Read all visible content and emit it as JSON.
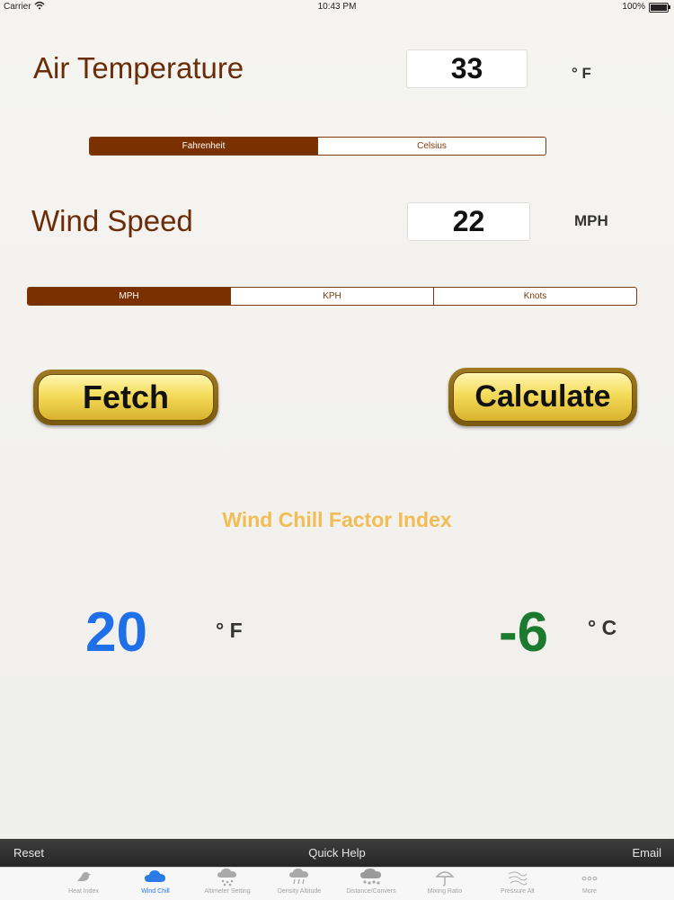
{
  "status_bar": {
    "carrier": "Carrier",
    "time": "10:43 PM",
    "battery": "100%"
  },
  "air_temperature": {
    "label": "Air Temperature",
    "value": "33",
    "unit": "° F",
    "unit_options": [
      "Fahrenheit",
      "Celsius"
    ],
    "selected": "Fahrenheit"
  },
  "wind_speed": {
    "label": "Wind Speed",
    "value": "22",
    "unit": "MPH",
    "unit_options": [
      "MPH",
      "KPH",
      "Knots"
    ],
    "selected": "MPH"
  },
  "buttons": {
    "fetch": "Fetch",
    "calculate": "Calculate"
  },
  "result": {
    "title": "Wind Chill Factor Index",
    "fahrenheit": "20",
    "fahrenheit_unit": "° F",
    "celsius": "-6",
    "celsius_unit": "° C"
  },
  "toolbar": {
    "reset": "Reset",
    "help": "Quick Help",
    "email": "Email"
  },
  "tabs": [
    {
      "label": "Heat Index",
      "icon": "bird-icon"
    },
    {
      "label": "Wind Chill",
      "icon": "cloud-icon",
      "active": true
    },
    {
      "label": "Altimeter Setting",
      "icon": "snow-cloud-icon"
    },
    {
      "label": "Density Altitude",
      "icon": "rain-cloud-icon"
    },
    {
      "label": "Distance/Convers",
      "icon": "storm-cloud-icon"
    },
    {
      "label": "Mixing Ratio",
      "icon": "umbrella-icon"
    },
    {
      "label": "Pressure Alt",
      "icon": "wind-icon"
    },
    {
      "label": "More",
      "icon": "more-icon"
    }
  ],
  "colors": {
    "label_brown": "#6b2d07",
    "segment_selected": "#7a3000",
    "result_title": "#f2bd55",
    "fahrenheit_blue": "#1e6fe8",
    "celsius_green": "#1b7a2e",
    "tab_active": "#2a7be6"
  }
}
